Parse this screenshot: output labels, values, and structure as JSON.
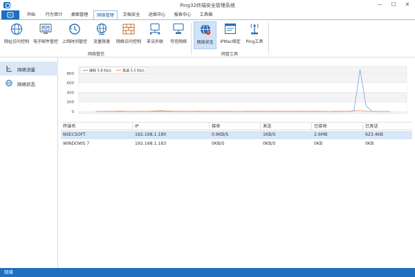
{
  "window": {
    "title": "Ping32终端安全管理系统",
    "min": "—",
    "max": "☐",
    "close": "✕"
  },
  "menu": {
    "file": "",
    "tabs": [
      "开始",
      "行为审计",
      "桌面管理",
      "网络管理",
      "文档安全",
      "运维中心",
      "报表中心",
      "工具箱"
    ],
    "active_index": 3
  },
  "ribbon": {
    "buttons": [
      {
        "label": "网址访问控制",
        "icon": "globe-icon"
      },
      {
        "label": "电子邮件管控",
        "icon": "mail-monitor-icon"
      },
      {
        "label": "上网时间管控",
        "icon": "clock-icon"
      },
      {
        "label": "流量限速",
        "icon": "globe-speed-icon"
      },
      {
        "label": "网络访问控制",
        "icon": "firewall-icon"
      },
      {
        "label": "非法外联",
        "icon": "network-pc-icon"
      },
      {
        "label": "可信网络",
        "icon": "trusted-network-icon"
      },
      {
        "label": "网络状态",
        "icon": "network-status-icon"
      },
      {
        "label": "IPMac绑定",
        "icon": "ipmac-window-icon"
      },
      {
        "label": "Ping工具",
        "icon": "antenna-icon"
      }
    ],
    "selected_index": 7,
    "groups": [
      "网络管控",
      "网管工具"
    ]
  },
  "leftnav": {
    "items": [
      {
        "label": "网络流量",
        "icon": "traffic-icon"
      },
      {
        "label": "网络状态",
        "icon": "globe-icon"
      }
    ],
    "active_index": 0
  },
  "chart_data": {
    "type": "line",
    "y_ticks": [
      "800",
      "600",
      "400",
      "200",
      "0"
    ],
    "ylim": [
      0,
      900
    ],
    "legend": [
      "接收 5.8 Kb/s",
      "发送 5.5 Kb/s"
    ],
    "legend_position": "top-left",
    "grid": true,
    "series": [
      {
        "name": "接收 5.8 Kb/s",
        "color": "#6fa6dc",
        "values": [
          0,
          0,
          1,
          0,
          2,
          0,
          0,
          1,
          0,
          0,
          1,
          3,
          0,
          0,
          1,
          0,
          0,
          2,
          0,
          0,
          1,
          0,
          0,
          0,
          1,
          0,
          0,
          2,
          0,
          0,
          1,
          0,
          0,
          0,
          1,
          0,
          0,
          0,
          2,
          0,
          1,
          0,
          0,
          20,
          880,
          120,
          0,
          0,
          0,
          0
        ]
      },
      {
        "name": "发送 5.5 Kb/s",
        "color": "#e8956a",
        "values": [
          0,
          2,
          5,
          3,
          8,
          4,
          2,
          6,
          3,
          5,
          12,
          18,
          10,
          6,
          4,
          5,
          3,
          7,
          4,
          3,
          5,
          6,
          4,
          3,
          2,
          4,
          6,
          5,
          4,
          3,
          5,
          4,
          3,
          6,
          4,
          3,
          5,
          4,
          3,
          2,
          4,
          3,
          4,
          10,
          20,
          6,
          3,
          2,
          2,
          1
        ]
      }
    ]
  },
  "table": {
    "columns": [
      "终端名",
      "IP",
      "接收",
      "发送",
      "已接收",
      "已发送"
    ],
    "rows": [
      [
        "NSECSOFT",
        "192.168.1.180",
        "0.9KB/S",
        "1KB/S",
        "2.6MB",
        "623.4KB"
      ],
      [
        "WINDOWS 7",
        "192.168.1.183",
        "0KB/S",
        "0KB/S",
        "0KB",
        "0KB"
      ]
    ],
    "selected_row": 0
  },
  "status": {
    "text": "就绪"
  }
}
